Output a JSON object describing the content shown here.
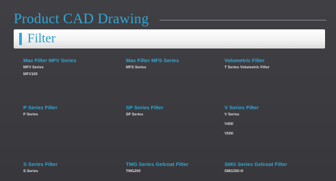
{
  "header": {
    "title": "Product CAD Drawing"
  },
  "filter_section": {
    "title": "Filter"
  },
  "items": [
    {
      "title": "Max Filter MFV Series",
      "lines": [
        "MFV Series",
        "MFV100"
      ]
    },
    {
      "title": "Max Filter MFS Series",
      "lines": [
        "MFS Series"
      ]
    },
    {
      "title": "Volumetric Filter",
      "lines": [
        "T Series Volumetric Filter"
      ]
    },
    {
      "title": "P Series Filter",
      "lines": [
        "P Series"
      ]
    },
    {
      "title": "SP Series Filter",
      "lines": [
        "SP Series"
      ]
    },
    {
      "title": "V Series Filter",
      "lines": [
        "V Series",
        "V400",
        "V500"
      ]
    },
    {
      "title": "S Series Filter",
      "lines": [
        "S Series"
      ]
    },
    {
      "title": "TMG Series Gelcoat Filter",
      "lines": [
        "TMG200"
      ]
    },
    {
      "title": "SMG Series Gelcoat Filter",
      "lines": [
        "SMG350-H"
      ]
    }
  ]
}
